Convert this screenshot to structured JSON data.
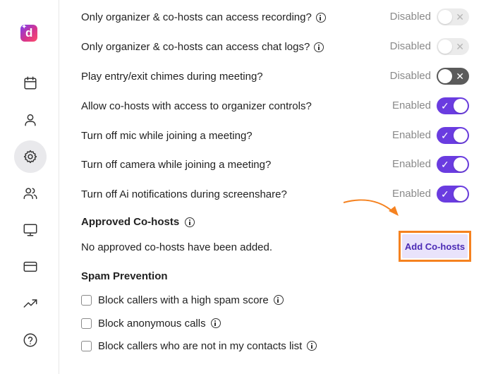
{
  "sidebar": {
    "logo_letter": "d",
    "items": [
      {
        "name": "calendar-icon",
        "active": false
      },
      {
        "name": "user-icon",
        "active": false
      },
      {
        "name": "gear-icon",
        "active": true
      },
      {
        "name": "users-icon",
        "active": false
      },
      {
        "name": "monitor-icon",
        "active": false
      },
      {
        "name": "credit-card-icon",
        "active": false
      },
      {
        "name": "trending-up-icon",
        "active": false
      },
      {
        "name": "help-circle-icon",
        "active": false
      }
    ]
  },
  "settings": [
    {
      "label": "Only organizer & co-hosts can access recording?",
      "info": true,
      "status": "Disabled",
      "enabled": false
    },
    {
      "label": "Only organizer & co-hosts can access chat logs?",
      "info": true,
      "status": "Disabled",
      "enabled": false
    },
    {
      "label": "Play entry/exit chimes during meeting?",
      "info": false,
      "status": "Disabled",
      "enabled": false
    },
    {
      "label": "Allow co-hosts with access to organizer controls?",
      "info": false,
      "status": "Enabled",
      "enabled": true
    },
    {
      "label": "Turn off mic while joining a meeting?",
      "info": false,
      "status": "Enabled",
      "enabled": true
    },
    {
      "label": "Turn off camera while joining a meeting?",
      "info": false,
      "status": "Enabled",
      "enabled": true
    },
    {
      "label": "Turn off Ai notifications during screenshare?",
      "info": false,
      "status": "Enabled",
      "enabled": true
    }
  ],
  "approved_cohosts": {
    "title": "Approved Co-hosts",
    "empty_text": "No approved co-hosts have been added.",
    "add_button": "Add Co-hosts",
    "highlight_color": "#f58220"
  },
  "spam_prevention": {
    "title": "Spam Prevention",
    "options": [
      {
        "label": "Block callers with a high spam score",
        "checked": false,
        "info": true
      },
      {
        "label": "Block anonymous calls",
        "checked": false,
        "info": true
      },
      {
        "label": "Block callers who are not in my contacts list",
        "checked": false,
        "info": true
      }
    ]
  },
  "colors": {
    "accent": "#6a3ce0",
    "toggle_off": "#ebebeb",
    "status_text": "#8a8a8a"
  }
}
